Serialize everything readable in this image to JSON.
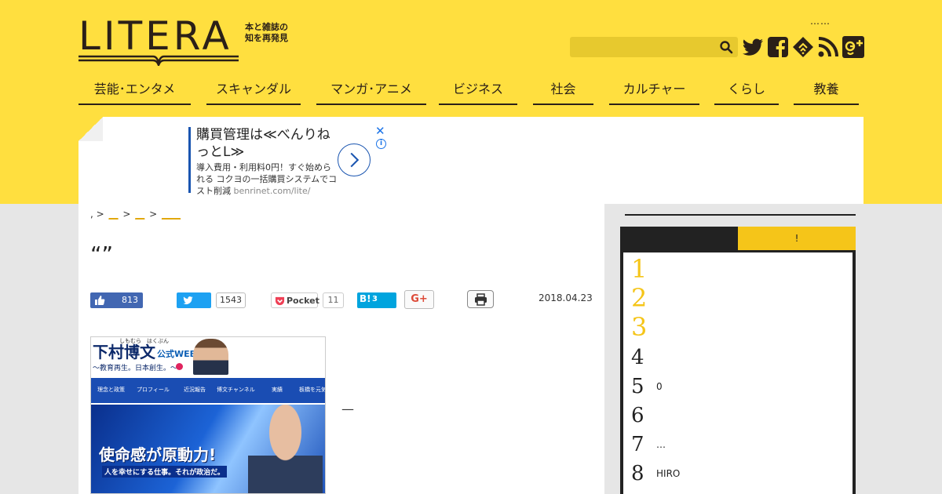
{
  "header": {
    "logo_text": "LITERA",
    "tagline": "本と雑誌の知を再発見",
    "top_link": "……",
    "search": {
      "placeholder": "",
      "value": ""
    },
    "social_icons": [
      "twitter-icon",
      "facebook-icon",
      "feedly-icon",
      "rss-icon",
      "google-plus-icon"
    ]
  },
  "nav": {
    "items": [
      {
        "label": "芸能･エンタメ"
      },
      {
        "label": "スキャンダル"
      },
      {
        "label": "マンガ･アニメ"
      },
      {
        "label": "ビジネス"
      },
      {
        "label": "社会"
      },
      {
        "label": "カルチャー"
      },
      {
        "label": "くらし"
      },
      {
        "label": "教養"
      }
    ]
  },
  "ad": {
    "title": "購買管理は≪べんりねっとL≫",
    "description": "導入費用・利用料0円！すぐ始められる コクヨの一括購買システムでコスト削減",
    "url": "benrinet.com/lite/",
    "close": "✕",
    "info": "i"
  },
  "breadcrumb": {
    "prefix": ",",
    "separator": ">",
    "links": [
      "__",
      "__",
      "____"
    ]
  },
  "article": {
    "title": "“”",
    "date": "2018.04.23",
    "body_dash": "—",
    "image": {
      "name_ruby": "しもむら　はくぶん",
      "name": "下村博文",
      "badge": "公式WEB",
      "slogan": "〜教育再生。日本創生。〜",
      "menu": [
        "理念と政策",
        "プロフィール",
        "近況報告",
        "博文チャンネル",
        "実績",
        "板橋を元気"
      ],
      "headline": "使命感が原動力!",
      "subline": "人を幸せにする仕事。それが政治だ。"
    }
  },
  "share": {
    "fb_count": "813",
    "twitter_count": "1543",
    "pocket_label": "Pocket",
    "pocket_count": "11",
    "hatena_label": "B!",
    "hatena_count": "3",
    "gplus_label": "G+"
  },
  "sidebar": {
    "tab_a": "",
    "tab_b": "!",
    "ranking": [
      {
        "rank": "1",
        "text": ""
      },
      {
        "rank": "2",
        "text": ""
      },
      {
        "rank": "3",
        "text": ""
      },
      {
        "rank": "4",
        "text": ""
      },
      {
        "rank": "5",
        "text": "0"
      },
      {
        "rank": "6",
        "text": ""
      },
      {
        "rank": "7",
        "text": "…"
      },
      {
        "rank": "8",
        "text": "HIRO"
      }
    ]
  },
  "colors": {
    "brand_yellow": "#ffdf3f",
    "rank_gold": "#f5c519",
    "dark": "#2b2018"
  }
}
